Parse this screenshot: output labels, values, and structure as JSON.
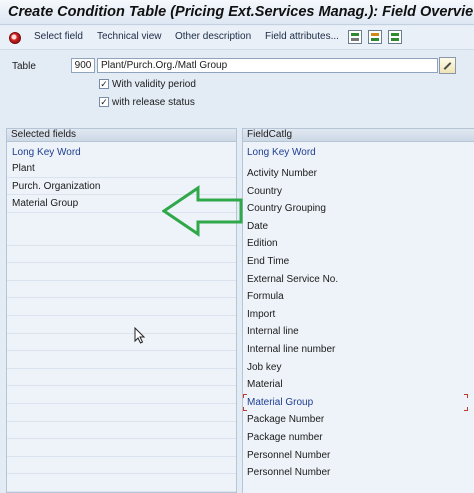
{
  "window": {
    "title": "Create Condition Table (Pricing Ext.Services Manag.): Field Overview"
  },
  "toolbar": {
    "execute_icon": "execute-icon",
    "buttons": [
      "Select field",
      "Technical view",
      "Other description",
      "Field attributes..."
    ],
    "icons": [
      "generate-icon",
      "delete-icon",
      "check-icon"
    ]
  },
  "header": {
    "table_label": "Table",
    "table_number": "900",
    "table_description": "Plant/Purch.Org./Matl Group",
    "checkboxes": [
      {
        "label": "With validity period",
        "checked": true
      },
      {
        "label": "with release status",
        "checked": true
      }
    ]
  },
  "selected_fields": {
    "title": "Selected fields",
    "column_header": "Long Key Word",
    "items": [
      "Plant",
      "Purch. Organization",
      "Material Group"
    ]
  },
  "field_catalog": {
    "title": "FieldCatlg",
    "column_header": "Long Key Word",
    "selected_item": "Material Group",
    "items": [
      "Activity Number",
      "Country",
      "Country Grouping",
      "Date",
      "Edition",
      "End Time",
      "External Service No.",
      "Formula",
      "Import",
      "Internal line",
      "Internal line number",
      "Job key",
      "Material",
      "Material Group",
      "Package Number",
      "Package number",
      "Personnel Number",
      "Personnel Number"
    ]
  },
  "colors": {
    "accent": "#1f3e91",
    "arrow": "#2fa84a",
    "panel_bg": "#eef3f9"
  }
}
